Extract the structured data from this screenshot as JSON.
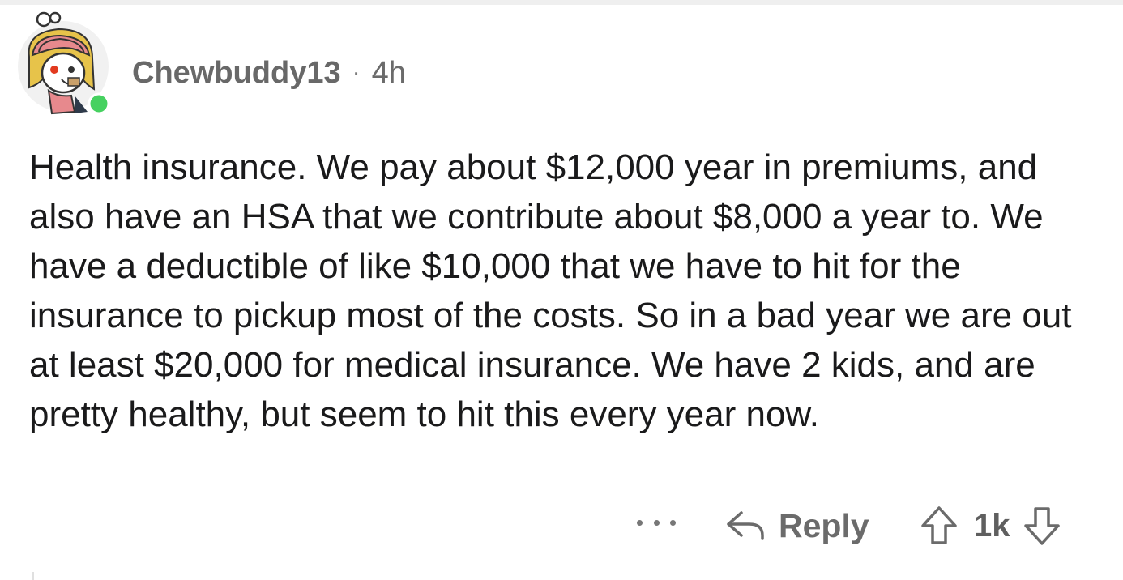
{
  "comment": {
    "author": "Chewbuddy13",
    "separator": "·",
    "age": "4h",
    "avatar_icon": "snoo-avatar-icon",
    "online_status_color": "#46d160",
    "body": "Health insurance. We pay about $12,000 year in premiums, and also have an HSA that we contribute about $8,000 a year to. We have a deductible of like $10,000 that we have to hit for the insurance to pickup most of the costs. So in a bad year we are out at least $20,000 for medical insurance. We have 2 kids, and are pretty healthy, but seem to hit this every year now."
  },
  "actions": {
    "more_icon": "more-dots-icon",
    "reply_icon": "reply-arrow-icon",
    "reply_label": "Reply",
    "upvote_icon": "upvote-arrow-icon",
    "vote_count": "1k",
    "downvote_icon": "downvote-arrow-icon"
  },
  "colors": {
    "text": "#1a1a1b",
    "meta": "#6b6b6b",
    "avatar_scarf": "#e7898d",
    "avatar_hair": "#e7c34a"
  }
}
